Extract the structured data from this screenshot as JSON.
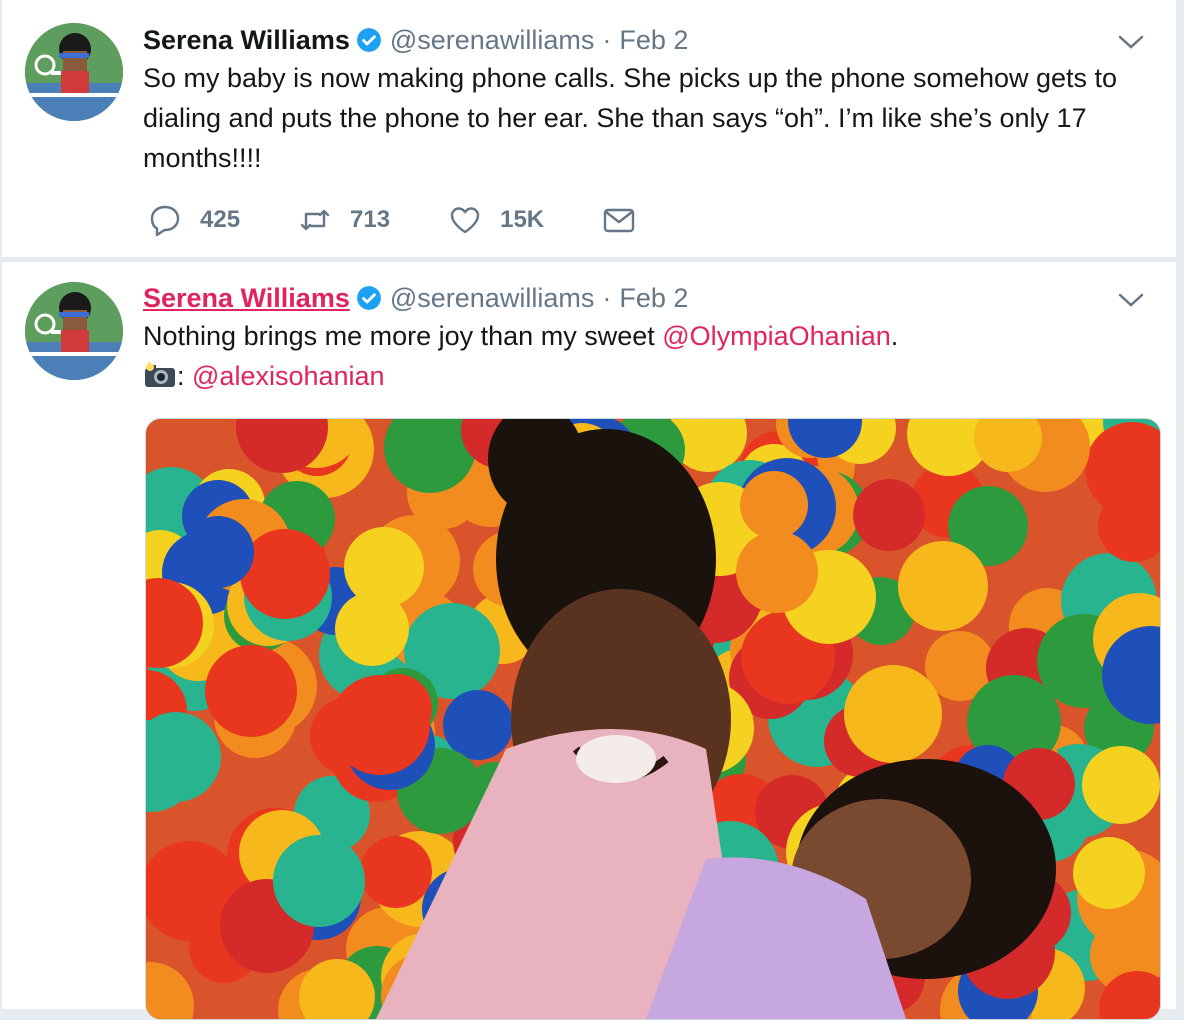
{
  "tweets": [
    {
      "author_name": "Serena Williams",
      "handle": "@serenawilliams",
      "separator": "·",
      "date": "Feb 2",
      "text": "So my baby is now making phone calls. She picks up the phone somehow gets to dialing and puts the phone to her ear. She than says “oh”. I’m like she’s only 17 months!!!!",
      "actions": {
        "replies": "425",
        "retweets": "713",
        "likes": "15K"
      }
    },
    {
      "author_name": "Serena Williams",
      "handle": "@serenawilliams",
      "separator": "·",
      "date": "Feb 2",
      "text_prefix": "Nothing brings me more joy than my sweet ",
      "mention_1": "@OlympiaOhanian",
      "text_suffix": ".",
      "photo_credit_sep": ": ",
      "mention_2": "@alexisohanian"
    }
  ],
  "colors": {
    "background": "#e6ecf0",
    "card": "#ffffff",
    "text": "#14171a",
    "secondary": "#657786",
    "link": "#e0245e",
    "verified": "#1da1f2"
  },
  "icons": [
    "avatar",
    "verified-badge-icon",
    "chevron-down-icon",
    "reply-icon",
    "retweet-icon",
    "like-icon",
    "direct-message-icon",
    "camera-flash-icon"
  ]
}
